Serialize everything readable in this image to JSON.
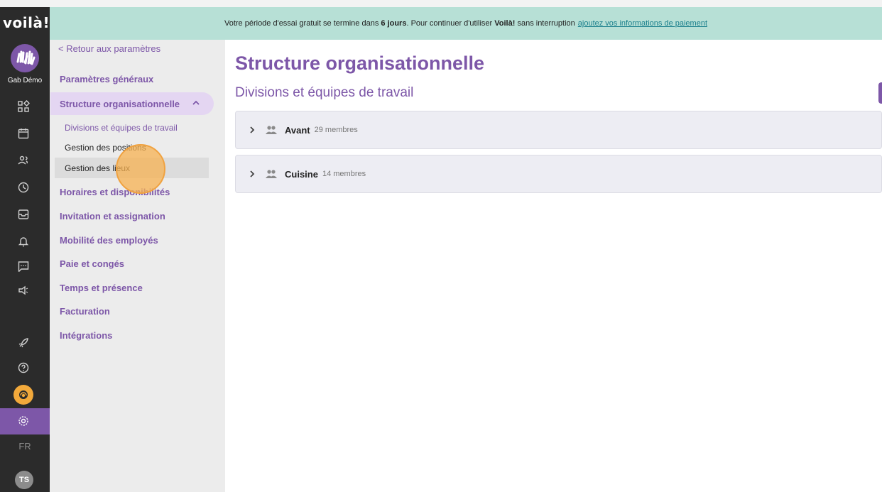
{
  "app": {
    "logo_text": "voilà!",
    "org_name": "Gab Démo",
    "language": "FR",
    "user_initials": "TS"
  },
  "banner": {
    "text_before": "Votre période d'essai gratuit se termine dans",
    "days": "6 jours",
    "text_middle": ". Pour continuer d'utiliser",
    "brand": "Voilà!",
    "text_after": "sans interruption",
    "link": "ajoutez vos informations de paiement"
  },
  "rail_icons": [
    "dashboard-icon",
    "calendar-icon",
    "people-icon",
    "clock-icon",
    "inbox-icon",
    "bell-icon",
    "chat-icon",
    "megaphone-icon",
    "rocket-icon",
    "help-icon",
    "support-agent-icon",
    "gear-icon"
  ],
  "sidebar": {
    "back": "< Retour aux paramètres",
    "items": [
      {
        "label": "Paramètres généraux"
      },
      {
        "label": "Structure organisationnelle"
      },
      {
        "label": "Horaires et disponibilités"
      },
      {
        "label": "Invitation et assignation"
      },
      {
        "label": "Mobilité des employés"
      },
      {
        "label": "Paie et congés"
      },
      {
        "label": "Temps et présence"
      },
      {
        "label": "Facturation"
      },
      {
        "label": "Intégrations"
      }
    ],
    "sub_items": [
      {
        "label": "Divisions et équipes de travail"
      },
      {
        "label": "Gestion des positions"
      },
      {
        "label": "Gestion des lieux"
      }
    ]
  },
  "main": {
    "title": "Structure organisationnelle",
    "subtitle": "Divisions et équipes de travail",
    "divisions": [
      {
        "name": "Avant",
        "count": "29 membres"
      },
      {
        "name": "Cuisine",
        "count": "14 membres"
      }
    ]
  },
  "colors": {
    "accent": "#7d57a8",
    "banner": "#b7e0d6",
    "rail": "#2b2b2b",
    "highlight": "#f2a93b"
  }
}
